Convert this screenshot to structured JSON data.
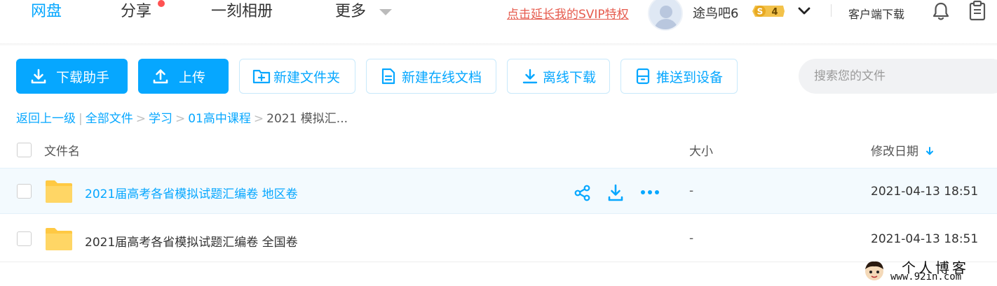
{
  "nav": {
    "tabs": [
      "网盘",
      "分享",
      "一刻相册",
      "更多"
    ],
    "svip_link": "点击延长我的SVIP特权",
    "username": "途鸟吧6",
    "vip_level": "4",
    "vip_symbol": "S",
    "client_download": "客户端下载"
  },
  "toolbar": {
    "download_helper": "下载助手",
    "upload": "上传",
    "new_folder": "新建文件夹",
    "new_online_doc": "新建在线文档",
    "offline_download": "离线下载",
    "push_to_device": "推送到设备",
    "search_placeholder": "搜索您的文件"
  },
  "breadcrumb": {
    "back": "返回上一级",
    "items": [
      "全部文件",
      "学习",
      "01高中课程"
    ],
    "current": "2021 模拟汇..."
  },
  "table": {
    "headers": {
      "name": "文件名",
      "size": "大小",
      "modified": "修改日期"
    },
    "rows": [
      {
        "name": "2021届高考各省模拟试题汇编卷 地区卷",
        "size": "-",
        "modified": "2021-04-13 18:51"
      },
      {
        "name": "2021届高考各省模拟试题汇编卷 全国卷",
        "size": "-",
        "modified": "2021-04-13 18:51"
      }
    ]
  },
  "watermark": {
    "title": "个人博客",
    "url": "www.92in.com"
  },
  "colors": {
    "accent": "#06a7ff",
    "svip_link": "#e65b4e",
    "row_hover": "#f3fafe",
    "folder": "#ffd665"
  }
}
